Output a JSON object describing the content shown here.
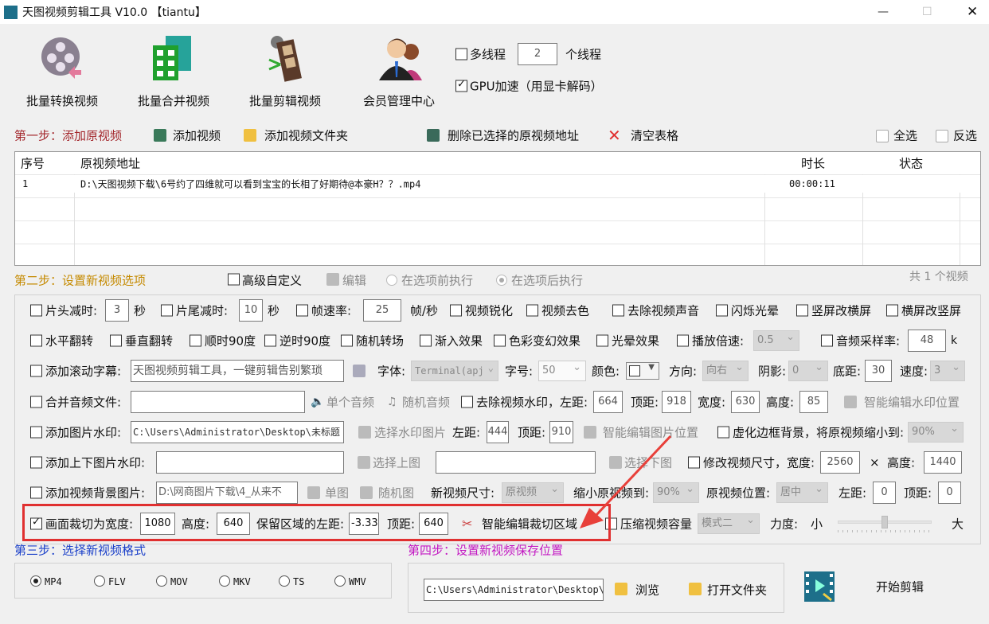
{
  "window": {
    "title": "天图视频剪辑工具 V10.0 【tiantu】",
    "minimize": "—",
    "maximize": "☐",
    "close": "✕"
  },
  "toolbar": {
    "convert": "批量转换视频",
    "merge": "批量合并视频",
    "edit": "批量剪辑视频",
    "member": "会员管理中心",
    "multithread": "多线程",
    "threads": "2",
    "threads_unit": "个线程",
    "gpu": "GPU加速（用显卡解码）"
  },
  "step1": {
    "title": "第一步：添加原视频",
    "add_video": "添加视频",
    "add_folder": "添加视频文件夹",
    "delete": "删除已选择的原视频地址",
    "clear": "清空表格",
    "select_all": "全选",
    "invert": "反选"
  },
  "table": {
    "headers": [
      "序号",
      "原视频地址",
      "时长",
      "状态"
    ],
    "rows": [
      {
        "no": "1",
        "path": "D:\\天图视频下载\\6号约了四维就可以看到宝宝的长相了好期待@本豪H？？.mp4",
        "duration": "00:00:11",
        "status": ""
      }
    ]
  },
  "step2": {
    "title": "第二步：设置新视频选项",
    "advanced": "高级自定义",
    "edit": "编辑",
    "before": "在选项前执行",
    "after": "在选项后执行",
    "count": "共 1 个视频"
  },
  "r1": {
    "head": "片头减时:",
    "head_v": "3",
    "sec": "秒",
    "tail": "片尾减时:",
    "tail_v": "10",
    "sec2": "秒",
    "fps": "帧速率:",
    "fps_v": "25",
    "fps_u": "帧/秒",
    "sharpen": "视频锐化",
    "decolor": "视频去色",
    "mute": "去除视频声音",
    "flash": "闪烁光晕",
    "v2h": "竖屏改横屏",
    "h2v": "横屏改竖屏"
  },
  "r2": {
    "hflip": "水平翻转",
    "vflip": "垂直翻转",
    "cw": "顺时90度",
    "ccw": "逆时90度",
    "trans": "随机转场",
    "fadein": "渐入效果",
    "color": "色彩变幻效果",
    "halo": "光晕效果",
    "speed": "播放倍速:",
    "speed_v": "0.5",
    "rate": "音频采样率:",
    "rate_v": "48",
    "rate_u": "k"
  },
  "r3": {
    "subtitle": "添加滚动字幕:",
    "subtitle_v": "天图视频剪辑工具，一键剪辑告别繁琐",
    "font": "字体:",
    "font_v": "Terminal(apj",
    "size": "字号:",
    "size_v": "50",
    "color": "颜色:",
    "dir": "方向:",
    "dir_v": "向右",
    "shadow": "阴影:",
    "shadow_v": "0",
    "bottom": "底距:",
    "bottom_v": "30",
    "speed": "速度:",
    "speed_v": "3"
  },
  "r4": {
    "audio": "合并音频文件:",
    "single": "单个音频",
    "random": "随机音频",
    "rmwm": "去除视频水印，左距:",
    "left_v": "664",
    "top": "顶距:",
    "top_v": "918",
    "width": "宽度:",
    "width_v": "630",
    "height": "高度:",
    "height_v": "85",
    "smart": "智能编辑水印位置"
  },
  "r5": {
    "imgwm": "添加图片水印:",
    "imgwm_v": "C:\\Users\\Administrator\\Desktop\\未标题",
    "choose": "选择水印图片",
    "left": "左距:",
    "left_v": "444",
    "top": "顶距:",
    "top_v": "910",
    "smart": "智能编辑图片位置",
    "blur": "虚化边框背景，将原视频缩小到:",
    "blur_v": "90%"
  },
  "r6": {
    "tb": "添加上下图片水印:",
    "up": "选择上图",
    "down": "选择下图",
    "resize": "修改视频尺寸，宽度:",
    "w_v": "2560",
    "x": "×",
    "h": "高度:",
    "h_v": "1440"
  },
  "r7": {
    "bg": "添加视频背景图片:",
    "bg_v": "D:\\网商图片下载\\4_从来不",
    "single": "单图",
    "random": "随机图",
    "newsize": "新视频尺寸:",
    "newsize_v": "原视频",
    "shrink": "缩小原视频到:",
    "shrink_v": "90%",
    "pos": "原视频位置:",
    "pos_v": "居中",
    "left": "左距:",
    "left_v": "0",
    "top": "顶距:",
    "top_v": "0"
  },
  "r8": {
    "crop": "画面裁切为宽度:",
    "crop_w": "1080",
    "h": "高度:",
    "h_v": "640",
    "left": "保留区域的左距:",
    "left_v": "-3.33",
    "top": "顶距:",
    "top_v": "640",
    "smart": "智能编辑裁切区域",
    "compress": "压缩视频容量",
    "mode_v": "模式二",
    "force": "力度:",
    "small": "小",
    "large": "大",
    "force_value": 0.5
  },
  "step3": {
    "title": "第三步：选择新视频格式",
    "formats": [
      "MP4",
      "FLV",
      "MOV",
      "MKV",
      "TS",
      "WMV"
    ],
    "selected": "MP4"
  },
  "step4": {
    "title": "第四步：设置新视频保存位置",
    "path": "C:\\Users\\Administrator\\Desktop\\",
    "browse": "浏览",
    "open": "打开文件夹",
    "start": "开始剪辑"
  },
  "colors": {
    "step1": "#a3272c",
    "step2": "#c58a00",
    "step3": "#1a3fc9",
    "step4": "#c217c2",
    "highlight": "#e03030"
  }
}
